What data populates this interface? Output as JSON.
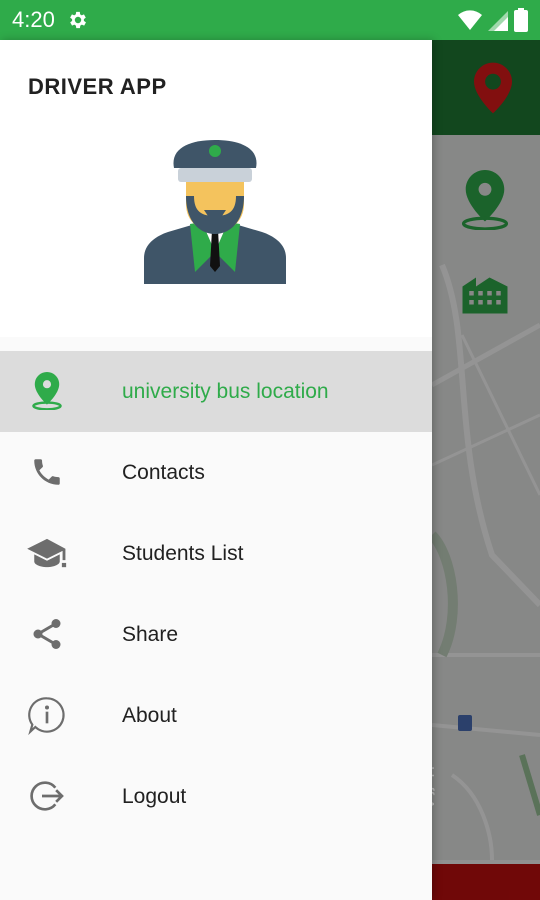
{
  "status_bar": {
    "time": "4:20"
  },
  "drawer": {
    "title": "DRIVER APP",
    "menu": [
      {
        "label": "university bus location",
        "icon": "location-pin-icon",
        "active": true
      },
      {
        "label": "Contacts",
        "icon": "phone-icon",
        "active": false
      },
      {
        "label": "Students List",
        "icon": "graduation-cap-icon",
        "active": false
      },
      {
        "label": "Share",
        "icon": "share-icon",
        "active": false
      },
      {
        "label": "About",
        "icon": "info-icon",
        "active": false
      },
      {
        "label": "Logout",
        "icon": "logout-icon",
        "active": false
      }
    ]
  },
  "background": {
    "street_label": "Huff Ave"
  },
  "colors": {
    "accent": "#2fab4a",
    "dark_green": "#1f7a34",
    "red": "#c20e0e",
    "active_bg": "#dcdcdc"
  }
}
